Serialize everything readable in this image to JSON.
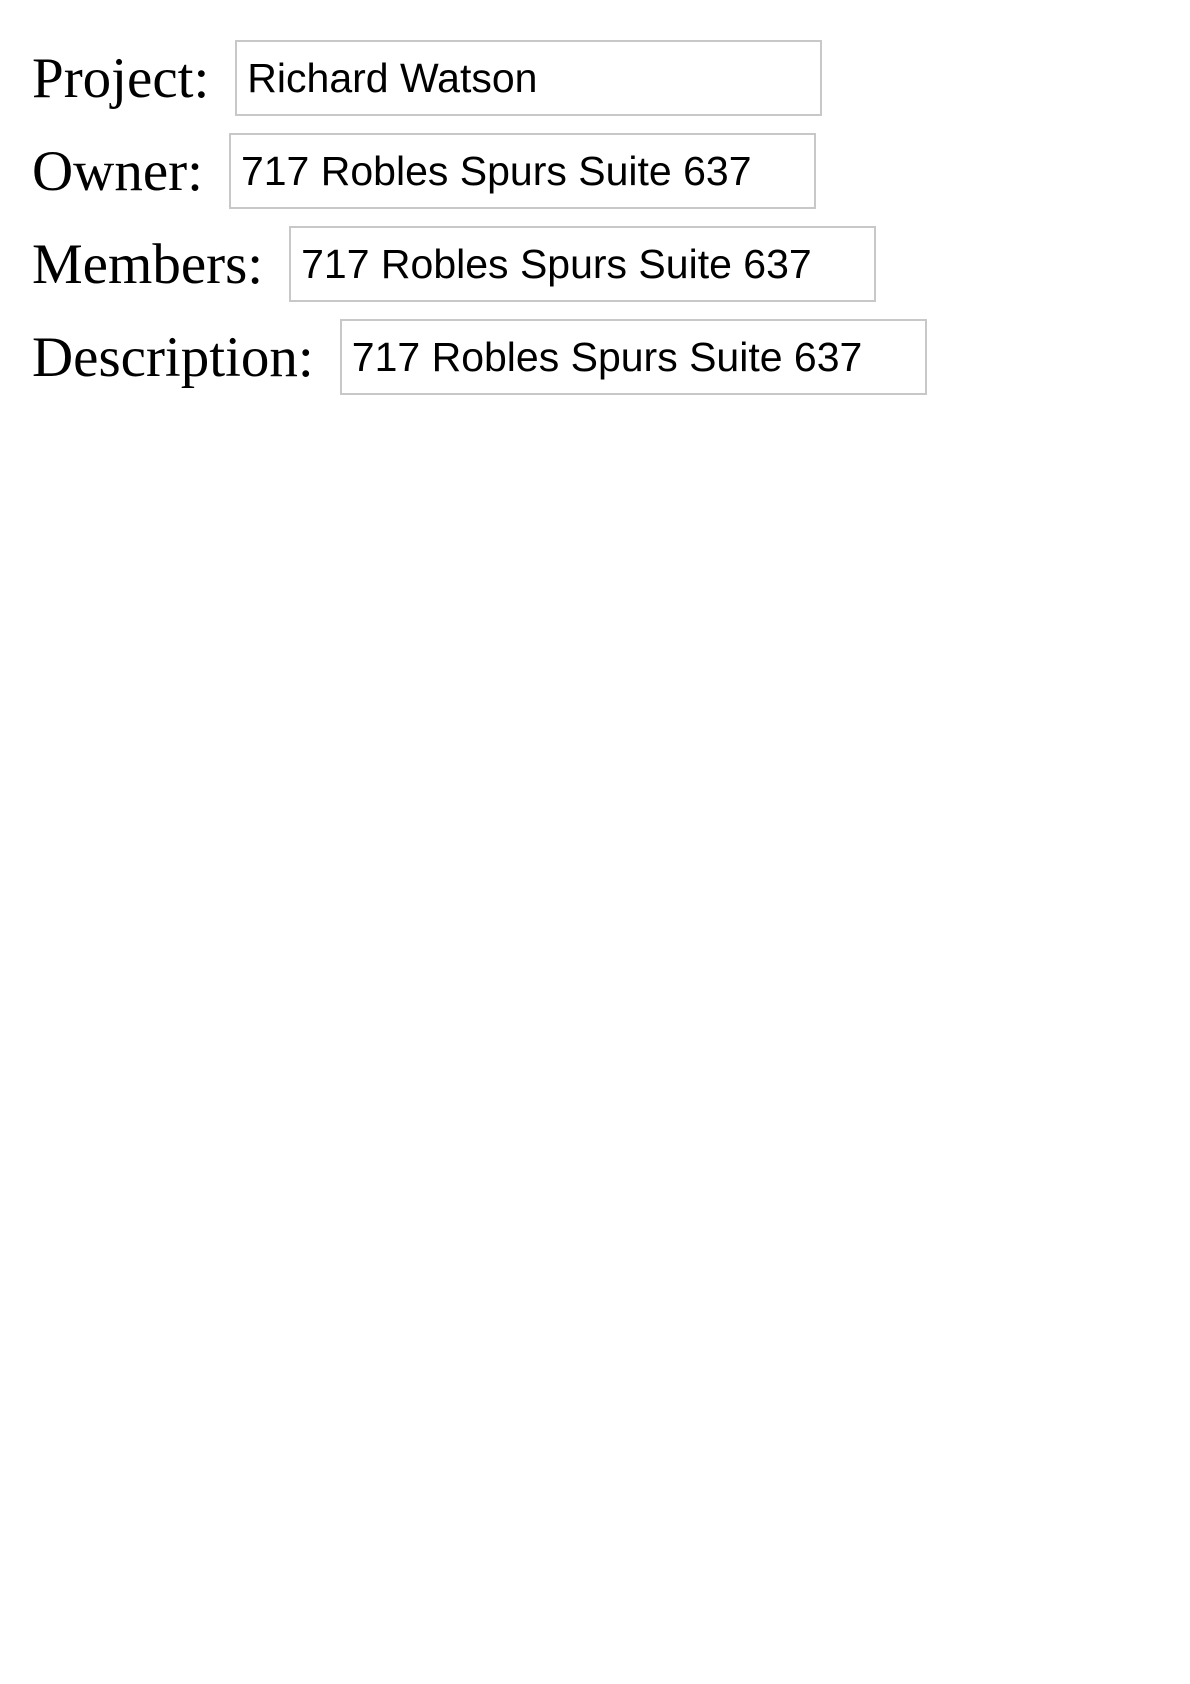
{
  "form": {
    "project": {
      "label": "Project:",
      "value": "Richard Watson"
    },
    "owner": {
      "label": "Owner:",
      "value": "717 Robles Spurs Suite 637"
    },
    "members": {
      "label": "Members:",
      "value": "717 Robles Spurs Suite 637"
    },
    "description": {
      "label": "Description:",
      "value": "717 Robles Spurs Suite 637"
    }
  }
}
